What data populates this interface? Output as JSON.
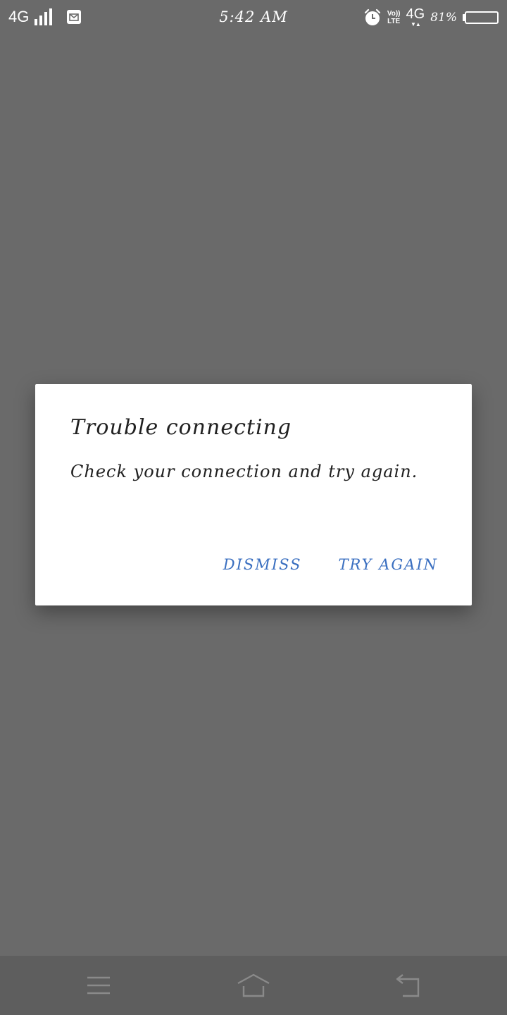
{
  "status_bar": {
    "network_left": "4G",
    "time": "5:42 AM",
    "volte_top": "Vo))",
    "volte_bottom": "LTE",
    "network_right": "4G",
    "network_right_arrows": "▼▲",
    "battery_percent": "81%",
    "battery_level": 0.81,
    "icons": [
      "signal-icon",
      "notification-icon",
      "alarm-icon",
      "battery-icon"
    ]
  },
  "dialog": {
    "title": "Trouble connecting",
    "message": "Check your connection and try again.",
    "dismiss_label": "DISMISS",
    "try_again_label": "TRY AGAIN"
  },
  "nav_bar": {
    "icons": [
      "menu-icon",
      "home-icon",
      "back-icon"
    ]
  },
  "colors": {
    "scrim": "#6a6a6a",
    "dialog_background": "#ffffff",
    "button_text": "#3a6fc0",
    "nav_bar": "#5e5e5e"
  }
}
